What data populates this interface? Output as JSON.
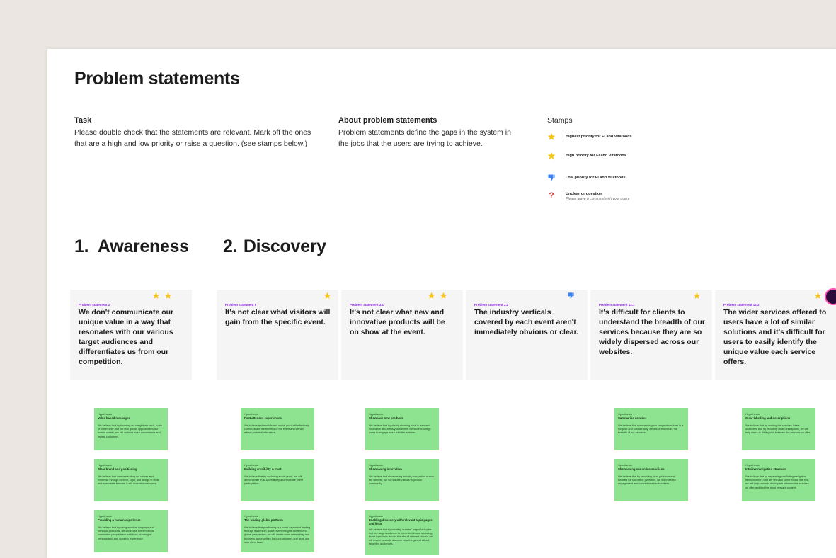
{
  "page": {
    "title": "Problem statements"
  },
  "task": {
    "heading": "Task",
    "body": "Please double check that the statements are relevant. Mark off the ones that are a high and low priority or raise a question. (see stamps below.)"
  },
  "about": {
    "heading": "About problem statements",
    "body": "Problem statements define the gaps in the system in the jobs that the users are trying to achieve."
  },
  "stamps": {
    "heading": "Stamps",
    "items": [
      {
        "icon": "star-icon",
        "label": "Highest priority for Fi and Vitafoods",
        "sub": ""
      },
      {
        "icon": "star-icon",
        "label": "High priority for Fi and Vitafoods",
        "sub": ""
      },
      {
        "icon": "thumbs-down-icon",
        "label": "Low priority  for Fi and Vitafoods",
        "sub": ""
      },
      {
        "icon": "question-icon",
        "label": "Unclear or question",
        "sub": "Please leave a comment with your query."
      }
    ]
  },
  "columns": [
    {
      "number": "1.",
      "title": "Awareness"
    },
    {
      "number": "2.",
      "title": "Discovery"
    }
  ],
  "cards": [
    {
      "label": "Problem statement 2",
      "text": "We don't communicate our unique value in a way that resonates with our various target audiences and differentiates us from our competition.",
      "stamps": [
        "star-icon",
        "star-icon"
      ]
    },
    {
      "label": "Problem statement 5",
      "text": "It's not clear what visitors will gain from the specific event.",
      "stamps": [
        "star-icon"
      ]
    },
    {
      "label": "Problem statement 3.1",
      "text": "It's not clear what new and innovative products will be on show at the event.",
      "stamps": [
        "star-icon",
        "star-icon"
      ]
    },
    {
      "label": "Problem statement 3.2",
      "text": "The industry verticals covered by each event aren't immediately obvious or clear.",
      "stamps": [
        "thumbs-down-icon"
      ]
    },
    {
      "label": "Problem statement 12.1",
      "text": "It's difficult for clients to understand the breadth of our services because they are so widely dispersed across our websites.",
      "stamps": [
        "star-icon"
      ]
    },
    {
      "label": "Problem statement 12.2",
      "text": "The wider services offered to users have a lot of similar solutions and it's difficult for users to easily identify the unique value each service offers.",
      "stamps": [
        "star-icon",
        "star-icon"
      ]
    }
  ],
  "notes": [
    {
      "label": "Hypothesis",
      "title": "Value based messages",
      "body": "We believe that by focusing on our global reach, scale of community and the real growth opportunities our events create, we will achieve more conversions and repeat customers."
    },
    {
      "label": "Hypothesis",
      "title": "Clear brand and positioning",
      "body": "We believe that communicating our values and expertise through content, copy, and design in clear and scannable formats, it will convert more users."
    },
    {
      "label": "Hypothesis",
      "title": "Providing a human experience",
      "body": "We believe that by using emotive language and personal pronouns, we will evoke the emotional connection people have with food, creating a personalised and dynamic experience."
    },
    {
      "label": "Hypothesis",
      "title": "Post attendee experiences",
      "body": "We believe testimonials and social proof will effectively communicate the benefits of the event and we will attract potential attendees."
    },
    {
      "label": "Hypothesis",
      "title": "Building credibility & trust",
      "body": "We believe that by surfacing social proof, we will demonstrate trust & credibility and increase event participation."
    },
    {
      "label": "Hypothesis",
      "title": "The leading global platform",
      "body": "We believe that positioning our event as market leading through leadership, scale, event/insights content and global perspective, we will create more networking and business opportunities for our customers and grow our own client base."
    },
    {
      "label": "Hypothesis",
      "title": "Showcase new products",
      "body": "We believe that by clearly showing what is new and innovative about this years event, we will encourage users to engage more with the website."
    },
    {
      "label": "Hypothesis",
      "title": "Showcasing innovation",
      "body": "We believe that showcasing industry innovation across the website, we will inspire visitors to join our community."
    },
    {
      "label": "Hypothesis",
      "title": "Enabling discovery with relevant topic pages and links",
      "body": "We believe that by creating 'curated' pages by topics that our target audience is interested in and surfacing those topic links across the site at relevant places, we will inspire users to discover new things and attract targetted audiences."
    },
    {
      "label": "Hypothesis",
      "title": "Summarise services",
      "body": "We believe that summarising our range of services in a singular and concise way, we will demonstrate the breadth of our services."
    },
    {
      "label": "Hypothesis",
      "title": "Showcasing our online solutions",
      "body": "We believe that by providing clear guidance and benefits for our online platforms, we will increase engagement and convert more subscribers."
    },
    {
      "label": "Hypothesis",
      "title": "Clear labelling and descriptions",
      "body": "We believe that by making the services labels distinctive and by including clear descriptions, we will help users to distinguish between the services on offer."
    },
    {
      "label": "Hypothesis",
      "title": "Intuitive navigation structure",
      "body": "We believe that by separating conflicting navigation items into tiers that are relevant to the 'focus' site first, we will help users to distinguish between the services on offer and find the most relevant content."
    }
  ],
  "colors": {
    "star": "#f5c518",
    "thumb": "#3b82f6",
    "question": "#e53935",
    "note": "#8de38f",
    "label": "#8a2be2"
  }
}
